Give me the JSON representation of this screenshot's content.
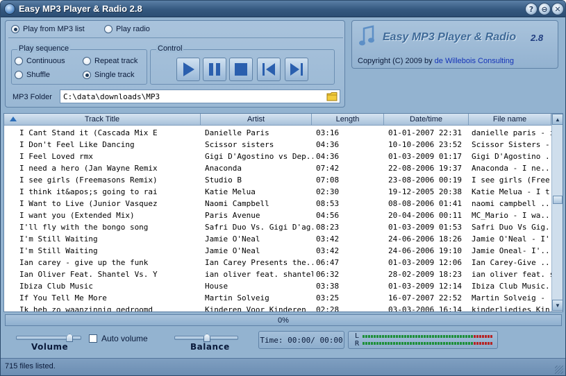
{
  "window": {
    "title": "Easy MP3 Player & Radio 2.8",
    "controls": [
      "?",
      "⊖",
      "✕"
    ]
  },
  "source": {
    "options": [
      {
        "label": "Play from MP3 list",
        "selected": true
      },
      {
        "label": "Play radio",
        "selected": false
      }
    ]
  },
  "sequence": {
    "title": "Play sequence",
    "options": [
      {
        "label": "Continuous",
        "selected": false
      },
      {
        "label": "Repeat track",
        "selected": false
      },
      {
        "label": "Shuffle",
        "selected": false
      },
      {
        "label": "Single track",
        "selected": true
      }
    ]
  },
  "control": {
    "title": "Control",
    "buttons": [
      "play-icon",
      "pause-icon",
      "stop-icon",
      "previous-icon",
      "next-icon"
    ],
    "accent": "#2a5fae"
  },
  "folder": {
    "label": "MP3 Folder",
    "value": "C:\\data\\downloads\\MP3"
  },
  "brand": {
    "name": "Easy MP3 Player & Radio",
    "version": "2.8",
    "copyright": "Copyright (C) 2009 by",
    "company": "de Willebois Consulting"
  },
  "table": {
    "columns": [
      "Track Title",
      "Artist",
      "Length",
      "Date/time",
      "File name"
    ],
    "rows": [
      [
        "I Cant Stand it (Cascada Mix E",
        "Danielle Paris",
        "03:16",
        "01-01-2007 22:31",
        "danielle paris - i..."
      ],
      [
        "I Don't Feel Like Dancing",
        "Scissor sisters",
        "04:36",
        "10-10-2006 23:52",
        "Scissor Sisters -..."
      ],
      [
        "I Feel Loved rmx",
        "Gigi D'Agostino vs Dep...",
        "04:36",
        "01-03-2009 01:17",
        "Gigi D'Agostino ..."
      ],
      [
        "I need a hero (Jan Wayne Remix",
        "Anaconda",
        "07:42",
        "22-08-2006 19:37",
        "Anaconda - I ne..."
      ],
      [
        "I see girls (Freemasons Remix)",
        "Studio B",
        "07:08",
        "23-08-2006 00:19",
        "I see girls (Free..."
      ],
      [
        "I think it&apos;s going to rai",
        "Katie Melua",
        "02:30",
        "19-12-2005 20:38",
        "Katie Melua - I t..."
      ],
      [
        "I Want to Live (Junior Vasquez",
        "Naomi Campbell",
        "08:53",
        "08-08-2006 01:41",
        "naomi campbell ..."
      ],
      [
        "I want you (Extended Mix)",
        "Paris Avenue",
        "04:56",
        "20-04-2006 00:11",
        "MC_Mario - I wa..."
      ],
      [
        "I'll fly with the bongo song",
        "Safri Duo Vs. Gigi D'ag...",
        "08:23",
        "01-03-2009 01:53",
        "Safri Duo Vs Gig..."
      ],
      [
        "I'm Still Waiting",
        "Jamie O'Neal",
        "03:42",
        "24-06-2006 18:26",
        "Jamie O'Neal - I'..."
      ],
      [
        "I'm Still Waiting",
        "Jamie O'Neal",
        "03:42",
        "24-06-2006 19:10",
        "Jamie Oneal- I'..."
      ],
      [
        "Ian carey - give up the funk",
        "Ian Carey Presents the...",
        "06:47",
        "01-03-2009 12:06",
        "Ian Carey-Give ..."
      ],
      [
        "Ian Oliver Feat. Shantel Vs. Y",
        "ian oliver feat. shantel ...",
        "06:32",
        "28-02-2009 18:23",
        "ian oliver feat. s..."
      ],
      [
        "Ibiza Club Music",
        "House",
        "03:38",
        "01-03-2009 12:14",
        "Ibiza Club Music..."
      ],
      [
        "If You Tell Me More",
        "Martin Solveig",
        "03:25",
        "16-07-2007 22:52",
        "Martin Solveig - ..."
      ],
      [
        "Ik heb zo waanzinnig gedroomd",
        "Kinderen Voor Kinderen",
        "02:28",
        "03-03-2006 16:14",
        "kinderliedies Kin..."
      ]
    ]
  },
  "progress": {
    "text": "0%",
    "value": 0
  },
  "volume": {
    "label": "Volume",
    "level": 0.85
  },
  "autovolume": {
    "label": "Auto volume",
    "checked": false
  },
  "balance": {
    "label": "Balance",
    "level": 0.5
  },
  "time": {
    "text": "Time: 00:00/ 00:00"
  },
  "meter": {
    "left_label": "L",
    "right_label": "R"
  },
  "status": {
    "text": "715 files listed."
  }
}
